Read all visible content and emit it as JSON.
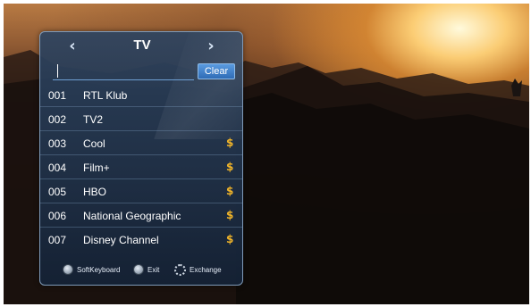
{
  "colors": {
    "panel_bg": "#233650",
    "panel_border": "#7f9ab8",
    "clear_button": "#3f80cc",
    "paid_icon": "#f0b429",
    "text": "#ffffff"
  },
  "header": {
    "title": "TV",
    "prev_icon": "chevron-left-icon",
    "next_icon": "chevron-right-icon"
  },
  "search": {
    "value": "",
    "placeholder": "",
    "clear_label": "Clear"
  },
  "channels": [
    {
      "number": "001",
      "name": "RTL Klub",
      "paid": ""
    },
    {
      "number": "002",
      "name": "TV2",
      "paid": ""
    },
    {
      "number": "003",
      "name": "Cool",
      "paid": "$"
    },
    {
      "number": "004",
      "name": "Film+",
      "paid": "$"
    },
    {
      "number": "005",
      "name": "HBO",
      "paid": "$"
    },
    {
      "number": "006",
      "name": "National Geographic",
      "paid": "$"
    },
    {
      "number": "007",
      "name": "Disney Channel",
      "paid": "$"
    }
  ],
  "footer": {
    "softkeyboard_label": "SoftKeyboard",
    "exit_label": "Exit",
    "exchange_label": "Exchange"
  }
}
